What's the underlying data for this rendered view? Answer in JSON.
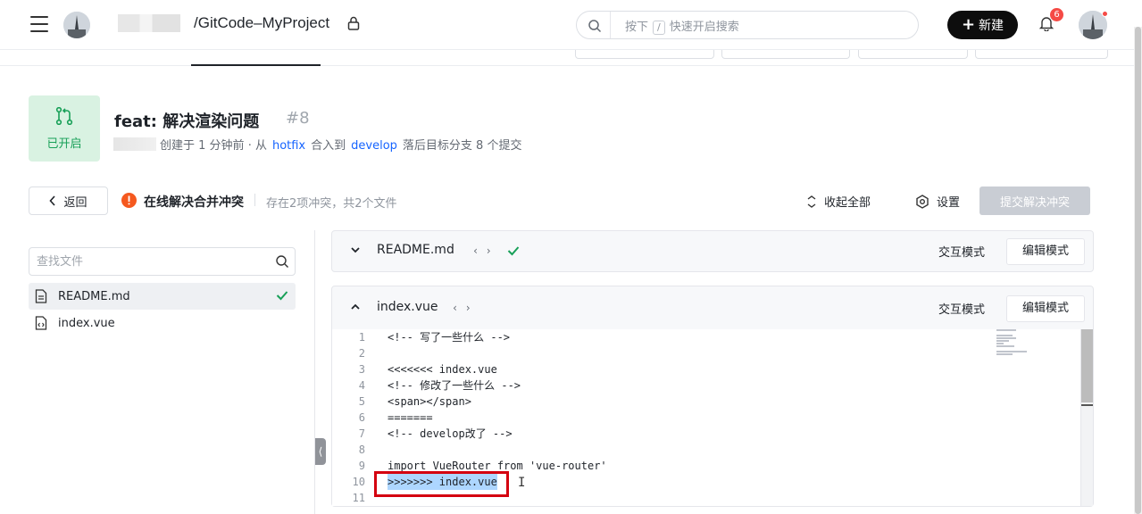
{
  "header": {
    "repo_path": "/GitCode–MyProject",
    "search_placeholder_prefix": "按下",
    "search_shortcut": "/",
    "search_placeholder_suffix": "快速开启搜索",
    "new_button": "新建",
    "notification_count": "6"
  },
  "mr": {
    "status": "已开启",
    "title": "feat: 解决渲染问题",
    "number": "#8",
    "created": "创建于 1 分钟前",
    "from_word": "· 从",
    "source_branch": "hotfix",
    "merge_word": "合入到",
    "target_branch": "develop",
    "behind_text": "落后目标分支 8 个提交"
  },
  "toolbar": {
    "back": "返回",
    "conflict_title": "在线解决合并冲突",
    "conflict_info": "存在2项冲突，共2个文件",
    "collapse_all": "收起全部",
    "settings": "设置",
    "submit": "提交解决冲突"
  },
  "file_panel": {
    "search_placeholder": "查找文件",
    "files": [
      {
        "name": "README.md",
        "resolved": true
      },
      {
        "name": "index.vue",
        "resolved": false
      }
    ]
  },
  "cards": [
    {
      "file": "README.md",
      "code_toggle": "‹ ›",
      "mode_interactive": "交互模式",
      "mode_edit": "编辑模式"
    },
    {
      "file": "index.vue",
      "code_toggle": "‹ ›",
      "mode_interactive": "交互模式",
      "mode_edit": "编辑模式",
      "lines": [
        {
          "n": "1",
          "code": "<!-- 写了一些什么 -->"
        },
        {
          "n": "2",
          "code": ""
        },
        {
          "n": "3",
          "code": "<<<<<<< index.vue"
        },
        {
          "n": "4",
          "code": "<!-- 修改了一些什么 -->"
        },
        {
          "n": "5",
          "code": "<span></span>"
        },
        {
          "n": "6",
          "code": "======="
        },
        {
          "n": "7",
          "code": "<!-- develop改了 -->"
        },
        {
          "n": "8",
          "code": ""
        },
        {
          "n": "9",
          "code": "import VueRouter from 'vue-router'"
        },
        {
          "n": "10",
          "code": ">>>>>>> index.vue"
        },
        {
          "n": "11",
          "code": ""
        }
      ]
    }
  ],
  "colors": {
    "accent_link": "#1664ff",
    "status_green": "#18a058",
    "warning": "#f5591f",
    "highlight_red": "#d4000f"
  }
}
